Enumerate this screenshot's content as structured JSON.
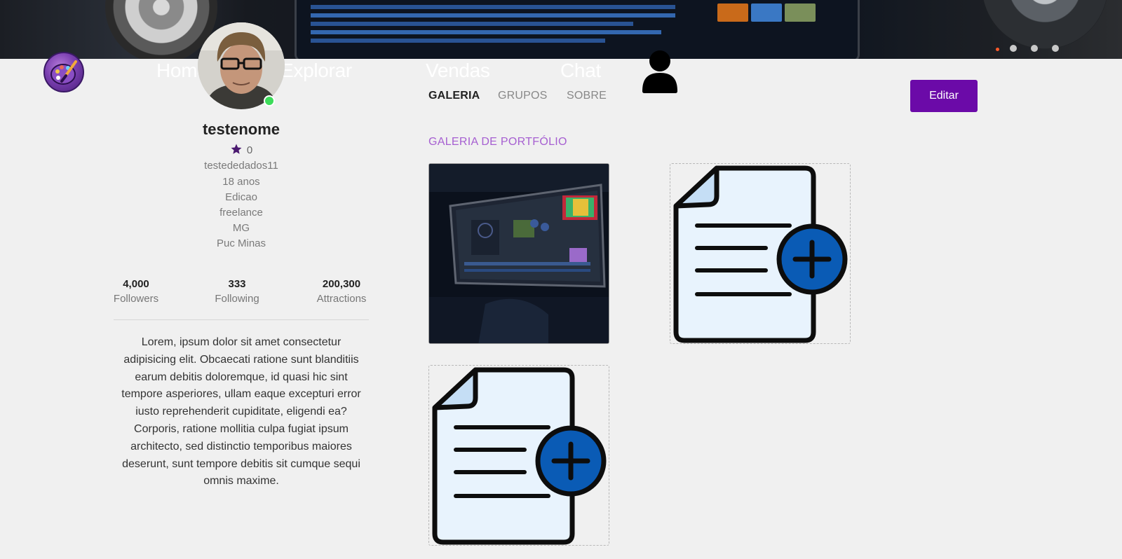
{
  "nav": {
    "home": "Home",
    "explore": "Explorar",
    "sales": "Vendas",
    "chat": "Chat",
    "logo_icon": "palette-brush-icon",
    "user_icon": "user-silhouette-icon"
  },
  "profile": {
    "username": "testenome",
    "rating": "0",
    "details": [
      "testededados11",
      "18 anos",
      "Edicao",
      "freelance",
      "MG",
      "Puc Minas"
    ],
    "online": true,
    "status_color": "#3ddc5a"
  },
  "stats": [
    {
      "value": "4,000",
      "label": "Followers"
    },
    {
      "value": "333",
      "label": "Following"
    },
    {
      "value": "200,300",
      "label": "Attractions"
    }
  ],
  "bio": "Lorem, ipsum dolor sit amet consectetur adipisicing elit. Obcaecati ratione sunt blanditiis earum debitis doloremque, id quasi hic sint tempore asperiores, ullam eaque excepturi error iusto reprehenderit cupiditate, eligendi ea? Corporis, ratione mollitia culpa fugiat ipsum architecto, sed distinctio temporibus maiores deserunt, sunt tempore debitis sit cumque sequi omnis maxime.",
  "tabs": [
    {
      "label": "GALERIA",
      "active": true
    },
    {
      "label": "GRUPOS",
      "active": false
    },
    {
      "label": "SOBRE",
      "active": false
    }
  ],
  "edit_button": "Editar",
  "gallery": {
    "title": "GALERIA DE PORTFÓLIO",
    "items": [
      {
        "type": "photo",
        "icon": "video-editing-photo"
      },
      {
        "type": "placeholder",
        "icon": "add-document-icon"
      },
      {
        "type": "placeholder",
        "icon": "add-document-icon"
      }
    ]
  },
  "colors": {
    "accent": "#6b0aa8",
    "section_title": "#a65fd1",
    "doc_fill": "#e8f3fd",
    "plus_circle": "#0a5bb5",
    "background": "#f0f0f0"
  }
}
